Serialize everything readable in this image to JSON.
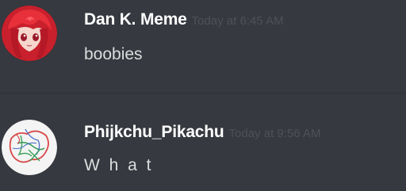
{
  "messages": [
    {
      "username": "Dan K. Meme",
      "timestamp": "Today at 6:45 AM",
      "content": "boobies",
      "avatar_icon": "anime-red-hair-avatar"
    },
    {
      "username": "Phijkchu_Pikachu",
      "timestamp": "Today at 9:56 AM",
      "content": "W h a t",
      "avatar_icon": "map-sketch-avatar"
    }
  ],
  "colors": {
    "background": "#36393f",
    "username": "#ffffff",
    "timestamp": "#4e5258",
    "message_text": "#dcddde",
    "divider": "#2f3136"
  }
}
